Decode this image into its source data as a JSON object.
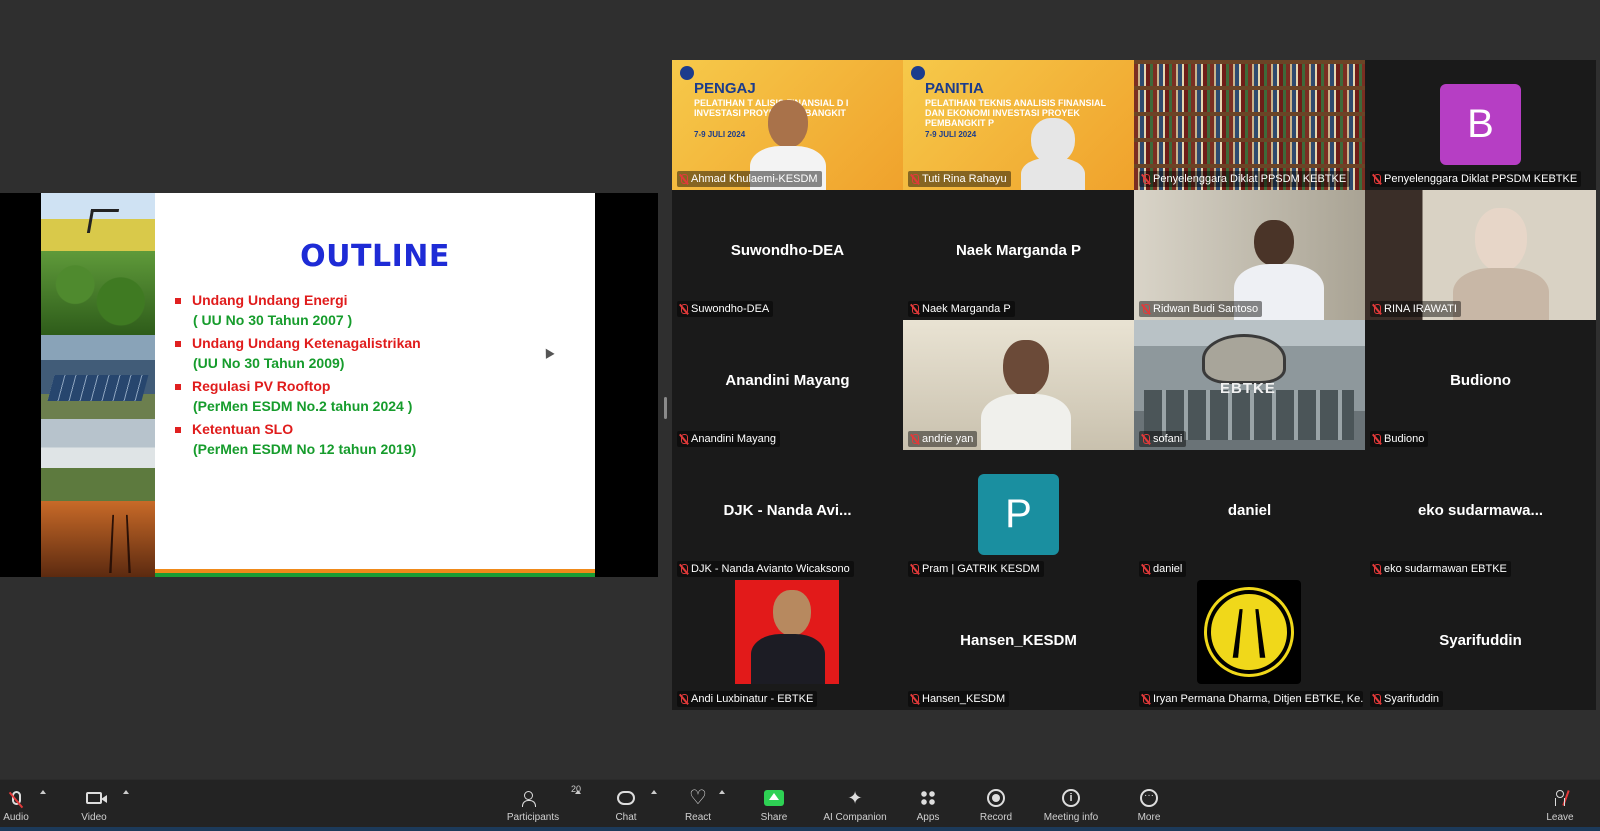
{
  "slide": {
    "title": "OUTLINE",
    "items": [
      {
        "heading": "Undang Undang Energi",
        "sub": "( UU No 30 Tahun 2007 )"
      },
      {
        "heading": "Undang Undang Ketenagalistrikan",
        "sub": "(UU No 30 Tahun 2009)"
      },
      {
        "heading": "Regulasi PV Rooftop",
        "sub": "(PerMen ESDM No.2 tahun 2024 )"
      },
      {
        "heading": "Ketentuan SLO",
        "sub": "(PerMen ESDM No 12 tahun 2019)"
      }
    ]
  },
  "banners": {
    "pengajar": {
      "title": "PENGAJ",
      "subtitle": "PELATIHAN T     ALISIS FINANSIAL D    I INVESTASI PROYEK PEN    BANGKIT",
      "date": "7-9 JULI 2024"
    },
    "panitia": {
      "title": "PANITIA",
      "subtitle": "PELATIHAN TEKNIS ANALISIS FINANSIAL DAN EKONOMI INVESTASI PROYEK PEMBANGKIT P",
      "date": "7-9 JULI 2024"
    }
  },
  "participants": [
    {
      "name": "Ahmad Khulaemi-KESDM",
      "big": "",
      "type": "video-pengajar"
    },
    {
      "name": "Tuti Rina Rahayu",
      "big": "",
      "type": "video-panitia"
    },
    {
      "name": "Penyelenggara Diklat PPSDM KEBTKE",
      "big": "",
      "type": "video-shelf"
    },
    {
      "name": "Penyelenggara Diklat PPSDM KEBTKE",
      "big": "",
      "avatar_letter": "B",
      "type": "avatar"
    },
    {
      "name": "Suwondho-DEA",
      "big": "Suwondho-DEA",
      "type": "name"
    },
    {
      "name": "Naek Marganda P",
      "big": "Naek Marganda P",
      "type": "name"
    },
    {
      "name": "Ridwan Budi Santoso",
      "big": "",
      "type": "video-office"
    },
    {
      "name": "RINA IRAWATI",
      "big": "",
      "type": "video-rina"
    },
    {
      "name": "Anandini Mayang",
      "big": "Anandini Mayang",
      "type": "name"
    },
    {
      "name": "andrie yan",
      "big": "",
      "type": "video-room"
    },
    {
      "name": "sofani",
      "big": "",
      "type": "video-bldg",
      "bg_text": "EBTKE"
    },
    {
      "name": "Budiono",
      "big": "Budiono",
      "type": "name"
    },
    {
      "name": "DJK - Nanda Avianto Wicaksono",
      "big": "DJK - Nanda Avi...",
      "type": "name"
    },
    {
      "name": "Pram | GATRIK KESDM",
      "big": "",
      "avatar_letter": "P",
      "type": "avatar"
    },
    {
      "name": "daniel",
      "big": "daniel",
      "type": "name"
    },
    {
      "name": "eko sudarmawan EBTKE",
      "big": "eko sudarmawa...",
      "type": "name"
    },
    {
      "name": "Andi Luxbinatur - EBTKE",
      "big": "",
      "type": "photo-red"
    },
    {
      "name": "Hansen_KESDM",
      "big": "Hansen_KESDM",
      "type": "name"
    },
    {
      "name": "Iryan Permana Dharma, Ditjen EBTKE, Ke...",
      "big": "",
      "type": "photo-emblem"
    },
    {
      "name": "Syarifuddin",
      "big": "Syarifuddin",
      "type": "name"
    }
  ],
  "toolbar": {
    "audio": "Audio",
    "video": "Video",
    "participants": "Participants",
    "participants_count": "20",
    "chat": "Chat",
    "react": "React",
    "share": "Share",
    "ai_companion": "AI Companion",
    "apps": "Apps",
    "record": "Record",
    "meeting_info": "Meeting info",
    "more": "More",
    "leave": "Leave"
  },
  "colors": {
    "background": "#2f2f2f",
    "active_speaker": "#2ed154",
    "share_green": "#2ed154",
    "muted_red": "#e23a3a",
    "slide_title_blue": "#1e2bd6",
    "slide_heading_red": "#e01c1c",
    "slide_sub_green": "#169c2c"
  }
}
